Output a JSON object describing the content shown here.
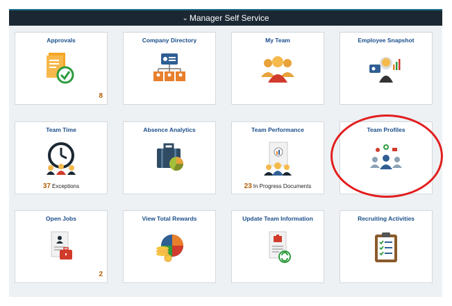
{
  "header": {
    "title": "Manager Self Service",
    "chevron_icon": "chevron-down-icon"
  },
  "colors": {
    "header_bg": "#1b2833",
    "accent": "#1a4e8a",
    "count": "#b35c00",
    "highlight": "#e21e1e"
  },
  "tiles": [
    {
      "title": "Approvals",
      "icon": "approvals-icon",
      "count": "8"
    },
    {
      "title": "Company Directory",
      "icon": "directory-icon"
    },
    {
      "title": "My Team",
      "icon": "team-icon"
    },
    {
      "title": "Employee Snapshot",
      "icon": "snapshot-icon"
    },
    {
      "title": "Team Time",
      "icon": "clock-icon",
      "summary_num": "37",
      "summary_text": "Exceptions"
    },
    {
      "title": "Absence Analytics",
      "icon": "briefcase-chart-icon"
    },
    {
      "title": "Team Performance",
      "icon": "performance-icon",
      "summary_num": "23",
      "summary_text": "In Progress Documents"
    },
    {
      "title": "Team Profiles",
      "icon": "profiles-icon"
    },
    {
      "title": "Open Jobs",
      "icon": "open-jobs-icon",
      "count": "2"
    },
    {
      "title": "View Total Rewards",
      "icon": "rewards-icon"
    },
    {
      "title": "Update Team Information",
      "icon": "update-info-icon"
    },
    {
      "title": "Recruiting Activities",
      "icon": "clipboard-icon"
    }
  ]
}
